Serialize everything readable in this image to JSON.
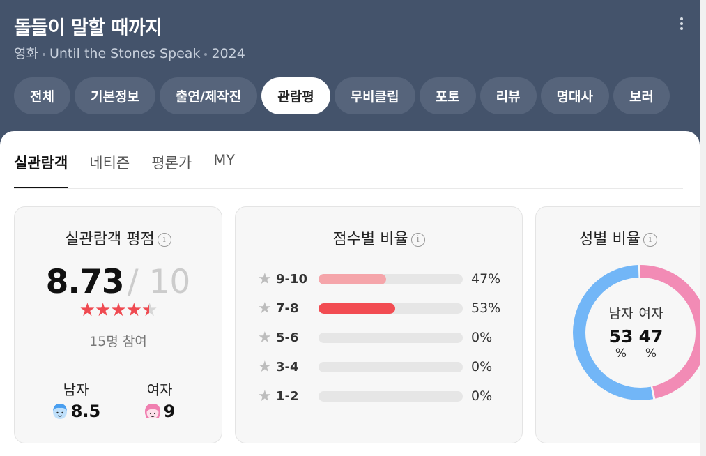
{
  "header": {
    "title": "돌들이 말할 때까지",
    "subtitle_type": "영화",
    "subtitle_original_title": "Until the Stones Speak",
    "subtitle_year": "2024",
    "more_icon": "more-vertical-icon"
  },
  "tabs": [
    {
      "label": "전체",
      "active": false
    },
    {
      "label": "기본정보",
      "active": false
    },
    {
      "label": "출연/제작진",
      "active": false
    },
    {
      "label": "관람평",
      "active": true
    },
    {
      "label": "무비클립",
      "active": false
    },
    {
      "label": "포토",
      "active": false
    },
    {
      "label": "리뷰",
      "active": false
    },
    {
      "label": "명대사",
      "active": false
    },
    {
      "label": "보러",
      "active": false
    }
  ],
  "subtabs": [
    {
      "label": "실관람객",
      "active": true
    },
    {
      "label": "네티즌",
      "active": false
    },
    {
      "label": "평론가",
      "active": false
    },
    {
      "label": "MY",
      "active": false
    }
  ],
  "rating_card": {
    "title": "실관람객 평점",
    "score": "8.73",
    "max": "/ 10",
    "stars_value": 4.5,
    "stars_max": 5,
    "participants": "15명 참여",
    "male_label": "남자",
    "male_score": "8.5",
    "female_label": "여자",
    "female_score": "9"
  },
  "distribution_card": {
    "title": "점수별 비율",
    "rows": [
      {
        "label": "9-10",
        "percent": 47,
        "percent_text": "47%",
        "color": "#f5a5aa"
      },
      {
        "label": "7-8",
        "percent": 53,
        "percent_text": "53%",
        "color": "#f24c52"
      },
      {
        "label": "5-6",
        "percent": 0,
        "percent_text": "0%",
        "color": "#f5a5aa"
      },
      {
        "label": "3-4",
        "percent": 0,
        "percent_text": "0%",
        "color": "#f5a5aa"
      },
      {
        "label": "1-2",
        "percent": 0,
        "percent_text": "0%",
        "color": "#f5a5aa"
      }
    ]
  },
  "gender_card": {
    "title": "성별 비율",
    "male_label": "남자",
    "male_value": "53",
    "female_label": "여자",
    "female_value": "47",
    "percent_sign": "%",
    "male_percent": 53,
    "female_percent": 47,
    "male_color": "#72b6f7",
    "female_color": "#f28bb5"
  },
  "colors": {
    "header_bg": "#44536b",
    "accent_red": "#ef4a51"
  }
}
